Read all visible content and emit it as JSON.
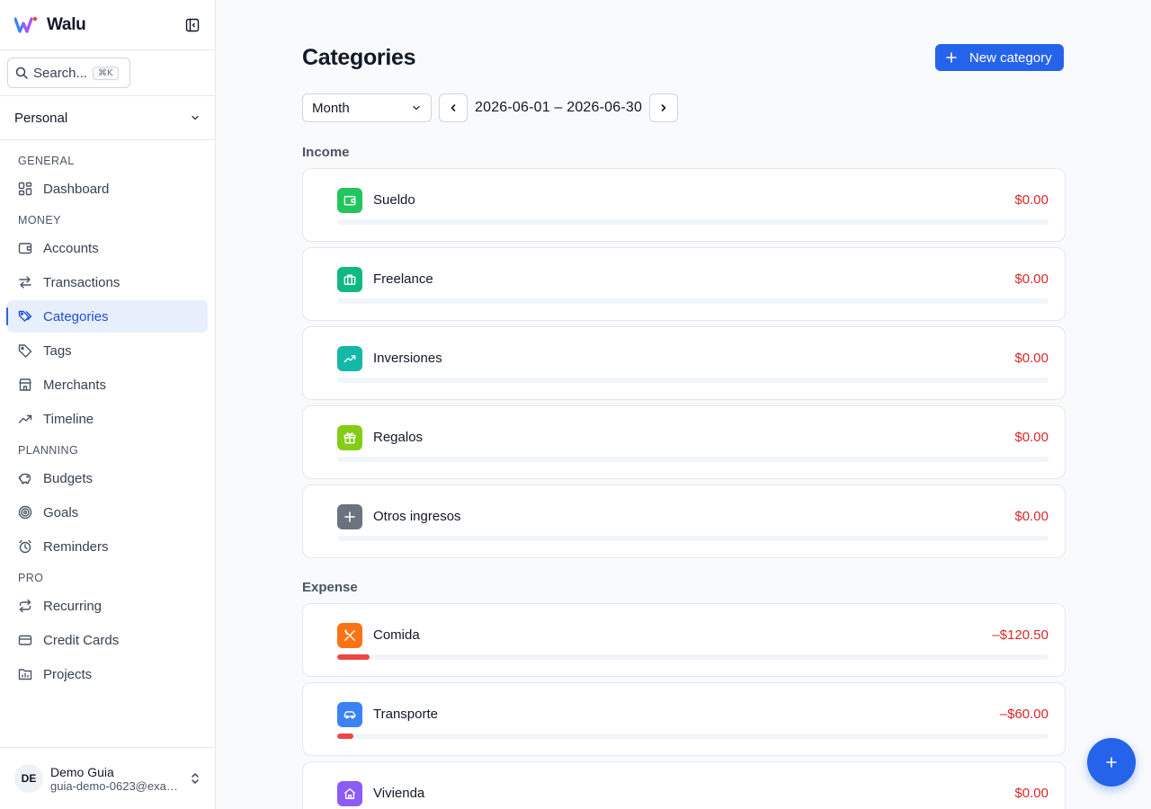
{
  "brand": {
    "name": "Walu"
  },
  "search": {
    "label": "Search...",
    "shortcut": "⌘K"
  },
  "workspace": {
    "name": "Personal"
  },
  "nav": {
    "sections": [
      {
        "title": "GENERAL",
        "items": [
          {
            "label": "Dashboard",
            "icon": "dashboard-icon"
          }
        ]
      },
      {
        "title": "MONEY",
        "items": [
          {
            "label": "Accounts",
            "icon": "wallet-icon"
          },
          {
            "label": "Transactions",
            "icon": "arrows-swap-icon"
          },
          {
            "label": "Categories",
            "icon": "tags-icon",
            "active": true
          },
          {
            "label": "Tags",
            "icon": "tag-icon"
          },
          {
            "label": "Merchants",
            "icon": "store-icon"
          },
          {
            "label": "Timeline",
            "icon": "trend-icon"
          }
        ]
      },
      {
        "title": "PLANNING",
        "items": [
          {
            "label": "Budgets",
            "icon": "piggy-bank-icon"
          },
          {
            "label": "Goals",
            "icon": "target-icon"
          },
          {
            "label": "Reminders",
            "icon": "alarm-icon"
          }
        ]
      },
      {
        "title": "PRO",
        "items": [
          {
            "label": "Recurring",
            "icon": "repeat-icon"
          },
          {
            "label": "Credit Cards",
            "icon": "credit-card-icon"
          },
          {
            "label": "Projects",
            "icon": "folder-chart-icon"
          }
        ]
      }
    ]
  },
  "user": {
    "initials": "DE",
    "name": "Demo Guia",
    "email": "guia-demo-0623@example.com"
  },
  "page": {
    "title": "Categories",
    "new_button": "New category",
    "period": "Month",
    "date_range": "2026-06-01 – 2026-06-30"
  },
  "income": {
    "label": "Income",
    "items": [
      {
        "name": "Sueldo",
        "amount": "$0.00",
        "icon": "wallet-icon",
        "color": "#22c55e",
        "progress": 0
      },
      {
        "name": "Freelance",
        "amount": "$0.00",
        "icon": "briefcase-icon",
        "color": "#10b981",
        "progress": 0
      },
      {
        "name": "Inversiones",
        "amount": "$0.00",
        "icon": "trend-up-icon",
        "color": "#14b8a6",
        "progress": 0
      },
      {
        "name": "Regalos",
        "amount": "$0.00",
        "icon": "gift-icon",
        "color": "#84cc16",
        "progress": 0
      },
      {
        "name": "Otros ingresos",
        "amount": "$0.00",
        "icon": "plus-icon",
        "color": "#6b7280",
        "progress": 0
      }
    ]
  },
  "expense": {
    "label": "Expense",
    "items": [
      {
        "name": "Comida",
        "amount": "–$120.50",
        "icon": "utensils-icon",
        "color": "#f97316",
        "progress": 0.046
      },
      {
        "name": "Transporte",
        "amount": "–$60.00",
        "icon": "car-icon",
        "color": "#3b82f6",
        "progress": 0.023
      },
      {
        "name": "Vivienda",
        "amount": "$0.00",
        "icon": "home-icon",
        "color": "#8b5cf6",
        "progress": 0
      }
    ]
  }
}
